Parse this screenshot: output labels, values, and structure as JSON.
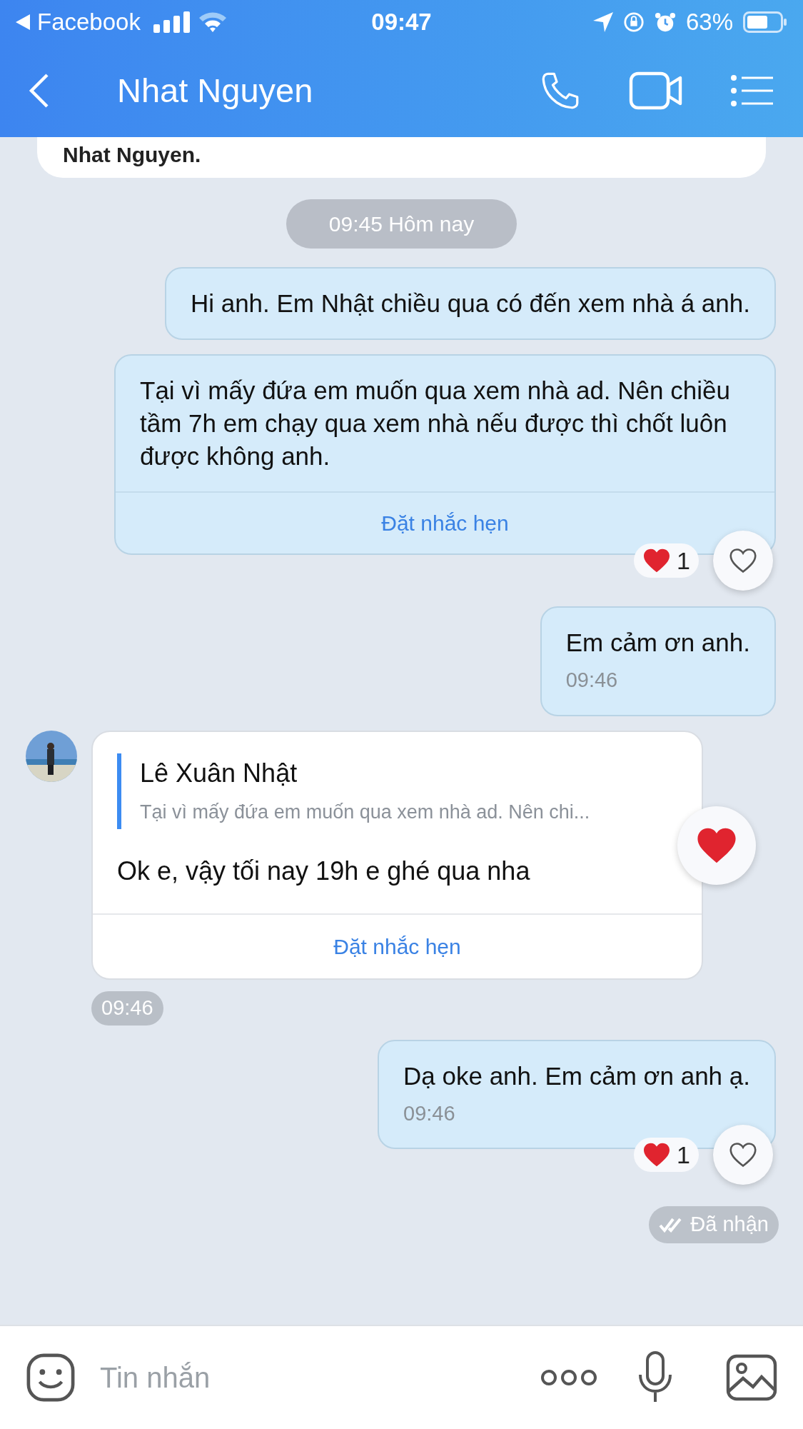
{
  "status_bar": {
    "back_app": "Facebook",
    "time": "09:47",
    "battery": "63%"
  },
  "header": {
    "title": "Nhat Nguyen"
  },
  "previous_card": {
    "text": "Nhat Nguyen."
  },
  "date_divider": "09:45 Hôm nay",
  "messages": [
    {
      "kind": "outgoing",
      "text": "Hi anh. Em Nhật chiều qua có đến xem nhà á anh."
    },
    {
      "kind": "outgoing",
      "text": "Tại vì mấy đứa em muốn qua xem nhà ad. Nên chiều tầm 7h em chạy qua xem nhà nếu được thì chốt luôn được không anh.",
      "action": "Đặt nhắc hẹn",
      "reaction_count": "1",
      "liked": false
    },
    {
      "kind": "outgoing",
      "text": "Em cảm ơn anh.",
      "time": "09:46"
    },
    {
      "kind": "incoming",
      "quote_name": "Lê Xuân Nhật",
      "quote_text": "Tại vì mấy đứa em muốn qua xem nhà ad. Nên chi...",
      "text": "Ok e, vậy tối nay 19h e ghé qua nha",
      "action": "Đặt nhắc hẹn",
      "liked": true,
      "time": "09:46"
    },
    {
      "kind": "outgoing",
      "text": "Dạ oke anh. Em cảm ơn anh ạ.",
      "time": "09:46",
      "reaction_count": "1",
      "liked": false
    }
  ],
  "delivery_status": "Đã nhận",
  "composer": {
    "placeholder": "Tin nhắn"
  }
}
